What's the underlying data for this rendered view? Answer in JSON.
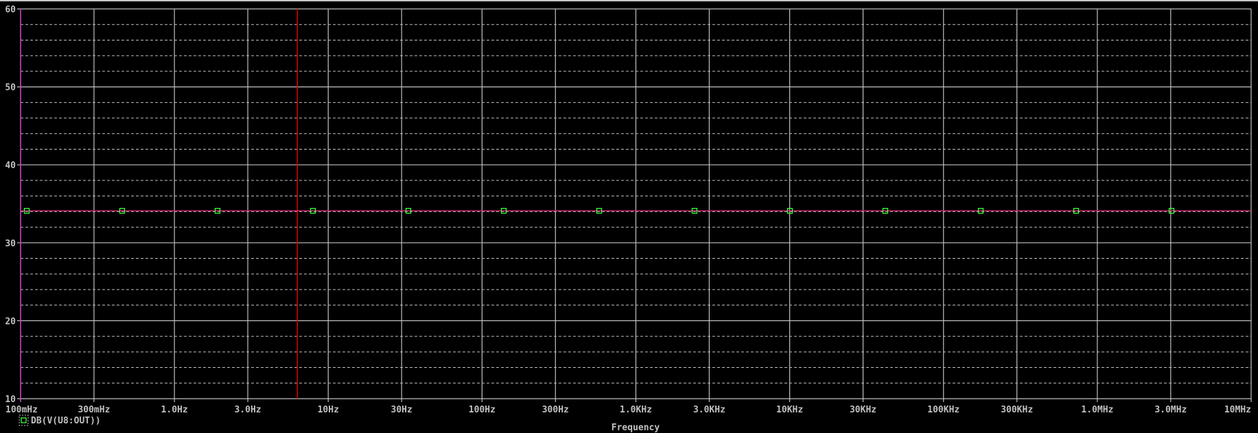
{
  "chart_data": {
    "type": "line",
    "title": "",
    "xlabel": "Frequency",
    "ylabel": "",
    "xscale": "log",
    "xlim": [
      0.1,
      10000000
    ],
    "ylim": [
      10,
      60
    ],
    "x_tick_values": [
      0.1,
      0.3,
      1,
      3,
      10,
      30,
      100,
      300,
      1000,
      3000,
      10000,
      30000,
      100000,
      300000,
      1000000,
      3000000,
      10000000
    ],
    "x_tick_labels": [
      "100mHz",
      "300mHz",
      "1.0Hz",
      "3.0Hz",
      "10Hz",
      "30Hz",
      "100Hz",
      "300Hz",
      "1.0KHz",
      "3.0KHz",
      "10KHz",
      "30KHz",
      "100KHz",
      "300KHz",
      "1.0MHz",
      "3.0MHz",
      "10MHz"
    ],
    "y_tick_values": [
      10,
      20,
      30,
      40,
      50,
      60
    ],
    "y_tick_labels": [
      "10",
      "20",
      "30",
      "40",
      "50",
      "60"
    ],
    "y_minor_step": 2,
    "grid": true,
    "legend_placement": "bottom-left",
    "cursor_x": 6.3,
    "series": [
      {
        "name": "DB(V(U8:OUT))",
        "x": [
          0.1,
          10000000
        ],
        "values": [
          34.1,
          34.1
        ],
        "color": "#c8286e",
        "marker_color": "#40ff40",
        "marker": "square"
      }
    ],
    "colors": {
      "grid": "#c0c0c0",
      "axis": "#c040c0",
      "cursor": "#e00000",
      "text": "#c0c0c0"
    }
  }
}
